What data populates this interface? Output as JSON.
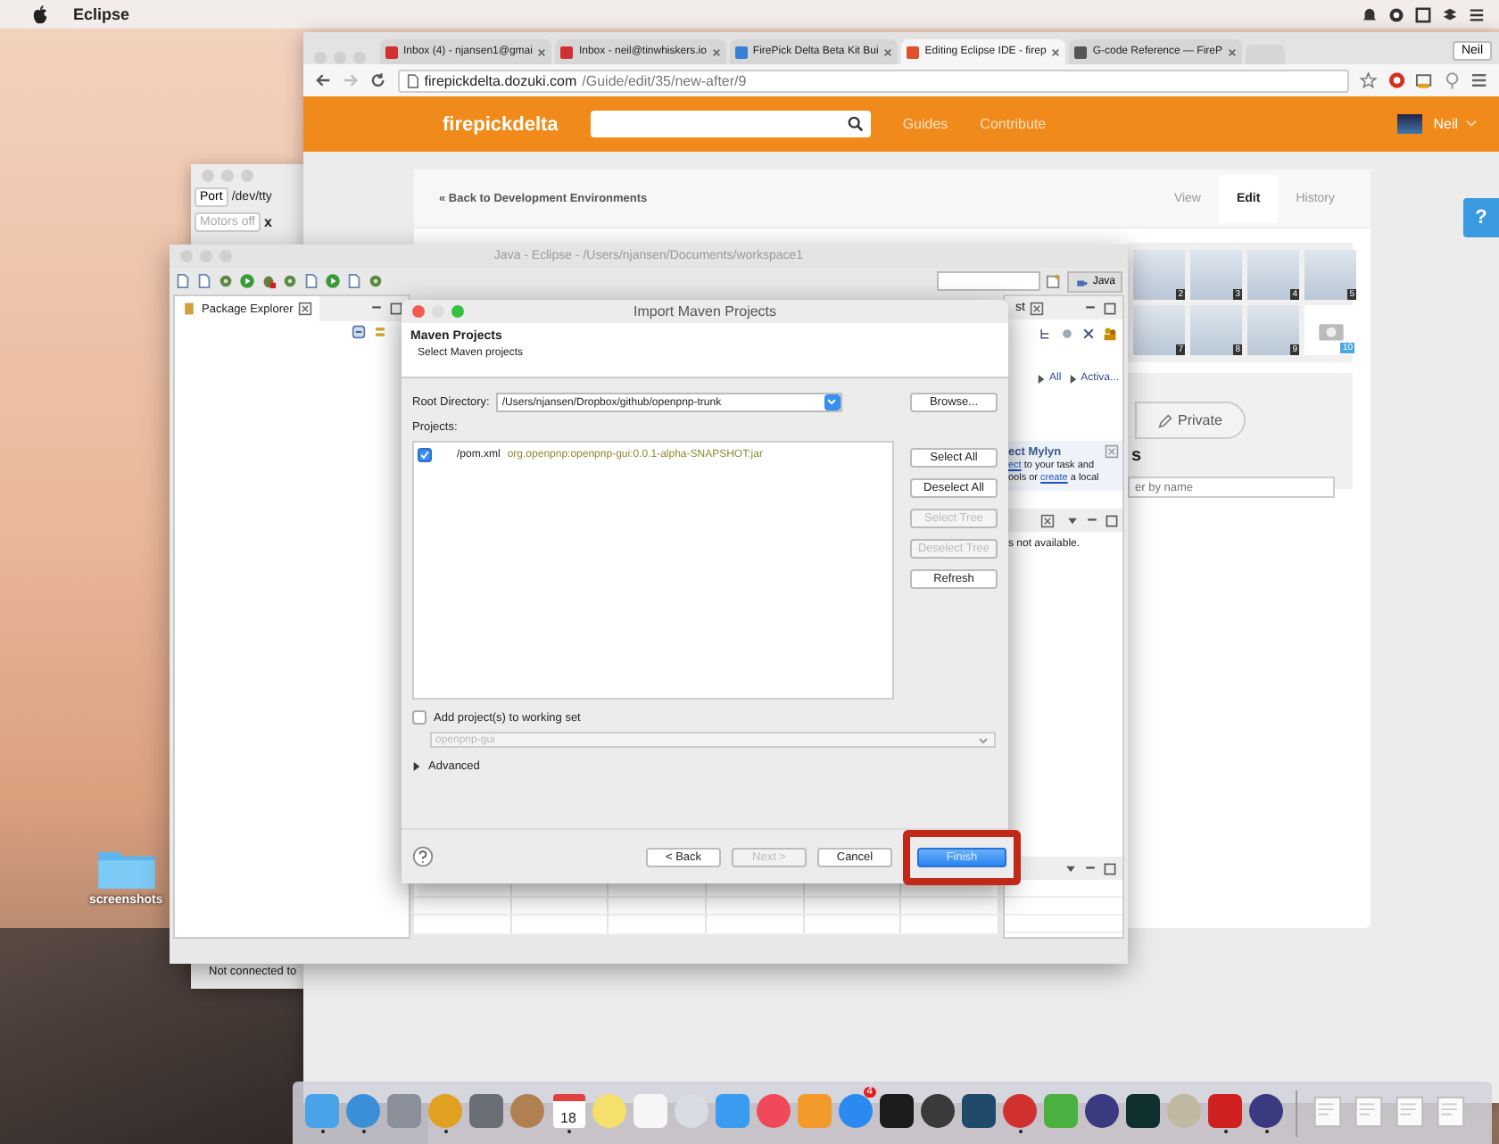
{
  "menubar": {
    "app_name": "Eclipse"
  },
  "desktop": {
    "folder_label": "screenshots"
  },
  "serial_window": {
    "port_button": "Port",
    "port_value": "/dev/tty",
    "motors_button": "Motors off",
    "motors_suffix": "x",
    "status": "Not connected to"
  },
  "browser": {
    "tabs": [
      {
        "title": "Inbox (4) - njansen1@gmai",
        "kind": "mail",
        "selected": false
      },
      {
        "title": "Inbox - neil@tinwhiskers.io",
        "kind": "mail",
        "selected": false
      },
      {
        "title": "FirePick Delta Beta Kit Bui",
        "kind": "doc",
        "selected": false
      },
      {
        "title": "Editing Eclipse IDE - firep",
        "kind": "site",
        "selected": true
      },
      {
        "title": "G-code Reference — FireP",
        "kind": "book",
        "selected": false
      }
    ],
    "profile_button": "Neil",
    "url_host": "firepickdelta.dozuki.com",
    "url_path": "/Guide/edit/35/new-after/9",
    "site": {
      "logo": "firepickdelta",
      "nav": [
        "Guides",
        "Contribute"
      ],
      "user": "Neil"
    },
    "back_link": "« Back to Development Environments",
    "mode_tabs": [
      {
        "label": "View",
        "selected": false
      },
      {
        "label": "Edit",
        "selected": true
      },
      {
        "label": "History",
        "selected": false
      }
    ],
    "thumbnails": [
      "2",
      "3",
      "4",
      "5",
      "7",
      "8",
      "9"
    ],
    "add_photo_number": "10",
    "private_button": "Private",
    "heading_fragment": "s",
    "filter_placeholder": "er by name",
    "help_button": "?"
  },
  "eclipse": {
    "title": "Java - Eclipse - /Users/njansen/Documents/workspace1",
    "perspective": "Java",
    "package_explorer": "Package Explorer",
    "task_tab": "st",
    "filters": [
      "All",
      "Activa..."
    ],
    "mylyn_title": "ect Mylyn",
    "mylyn_lines": [
      {
        "link": "ect",
        "after": " to your task and"
      },
      {
        "before": "ools or ",
        "link": "create",
        "after": " a local"
      }
    ],
    "outline_message": "s not available."
  },
  "dialog": {
    "title": "Import Maven Projects",
    "heading": "Maven Projects",
    "subheading": "Select Maven projects",
    "root_label": "Root Directory:",
    "root_value": "/Users/njansen/Dropbox/github/openpnp-trunk",
    "browse_button": "Browse...",
    "projects_label": "Projects:",
    "projects": [
      {
        "file": "/pom.xml",
        "artifact": "org.openpnp:openpnp-gui:0.0.1-alpha-SNAPSHOT:jar",
        "checked": true
      }
    ],
    "side_buttons": [
      {
        "label": "Select All",
        "disabled": false
      },
      {
        "label": "Deselect All",
        "disabled": false
      },
      {
        "label": "Select Tree",
        "disabled": true
      },
      {
        "label": "Deselect Tree",
        "disabled": true
      },
      {
        "label": "Refresh",
        "disabled": false
      }
    ],
    "working_set": {
      "label": "Add project(s) to working set",
      "checked": false,
      "value": "openpnp-gui",
      "disabled": true
    },
    "advanced": {
      "label": "Advanced",
      "expanded": false
    },
    "footer_buttons": [
      {
        "label": "< Back",
        "disabled": false,
        "default": false,
        "highlighted": false
      },
      {
        "label": "Next >",
        "disabled": true,
        "default": false,
        "highlighted": false
      },
      {
        "label": "Cancel",
        "disabled": false,
        "default": false,
        "highlighted": false
      },
      {
        "label": "Finish",
        "disabled": false,
        "default": true,
        "highlighted": true
      }
    ]
  },
  "dock": {
    "items": [
      {
        "kind": "app",
        "running": true
      },
      {
        "kind": "app",
        "running": true
      },
      {
        "kind": "app",
        "running": false
      },
      {
        "kind": "app",
        "running": true
      },
      {
        "kind": "app",
        "running": false
      },
      {
        "kind": "app",
        "running": false
      },
      {
        "kind": "calendar",
        "running": true,
        "date": "18"
      },
      {
        "kind": "app",
        "running": false
      },
      {
        "kind": "app",
        "running": false
      },
      {
        "kind": "app",
        "running": false
      },
      {
        "kind": "app",
        "running": false
      },
      {
        "kind": "app",
        "running": false
      },
      {
        "kind": "app",
        "running": false
      },
      {
        "kind": "app",
        "running": false,
        "badge": "4"
      },
      {
        "kind": "app",
        "running": false
      },
      {
        "kind": "app",
        "running": false
      },
      {
        "kind": "app",
        "running": false
      },
      {
        "kind": "app",
        "running": true
      },
      {
        "kind": "app",
        "running": false
      },
      {
        "kind": "app",
        "running": false
      },
      {
        "kind": "app",
        "running": false
      },
      {
        "kind": "app",
        "running": false
      },
      {
        "kind": "app",
        "running": true
      },
      {
        "kind": "app",
        "running": true
      },
      {
        "kind": "document",
        "running": false
      },
      {
        "kind": "document",
        "running": false
      },
      {
        "kind": "document",
        "running": false
      },
      {
        "kind": "document",
        "running": false
      }
    ]
  }
}
